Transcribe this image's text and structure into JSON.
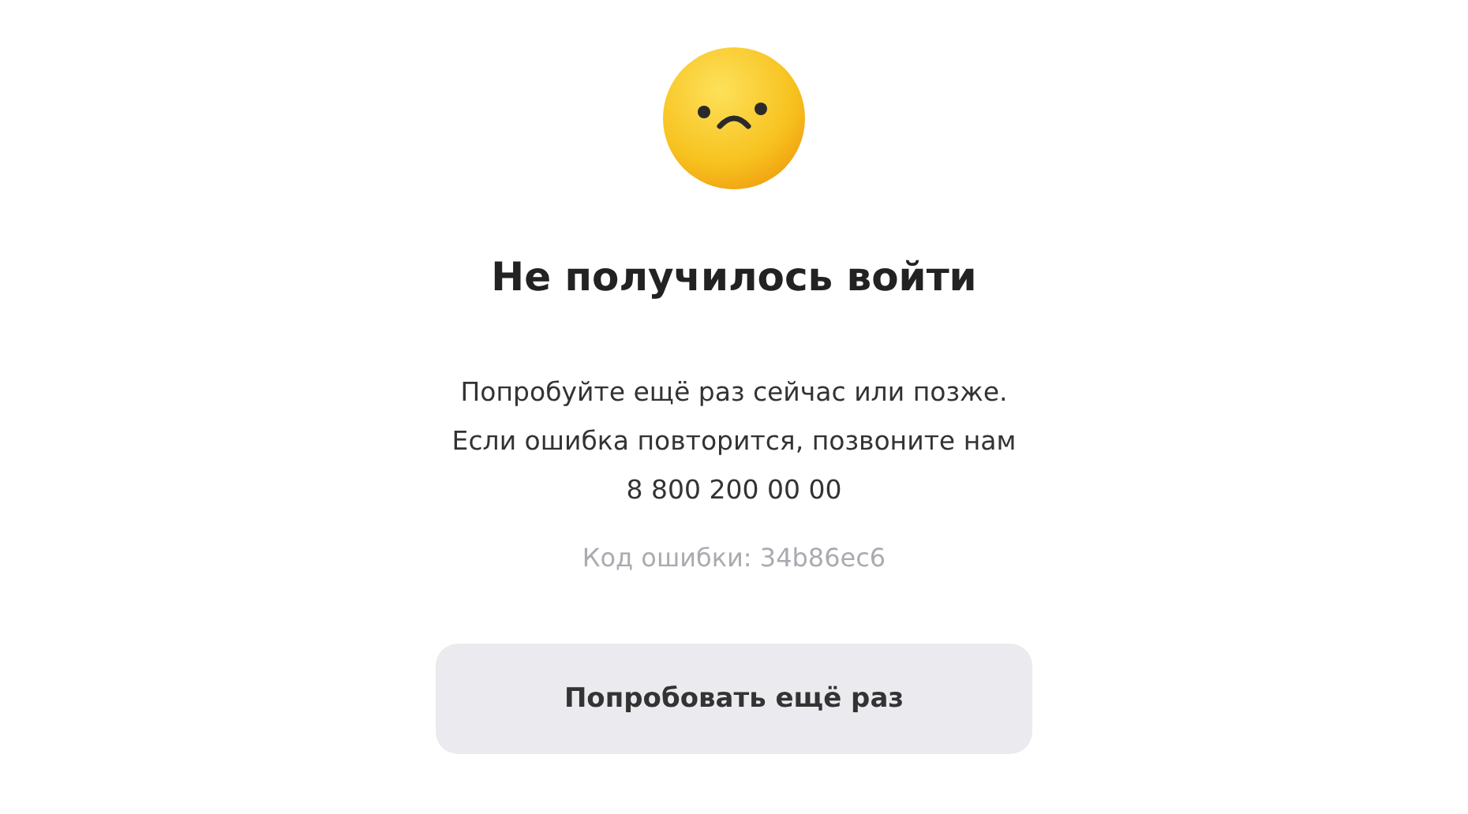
{
  "title": "Не получилось войти",
  "message_lines": [
    "Попробуйте ещё раз сейчас или позже.",
    "Если ошибка повторится, позвоните нам"
  ],
  "phone": "8 800 200 00 00",
  "error_code": "Код ошибки: 34b86ec6",
  "retry_button": "Попробовать ещё раз"
}
